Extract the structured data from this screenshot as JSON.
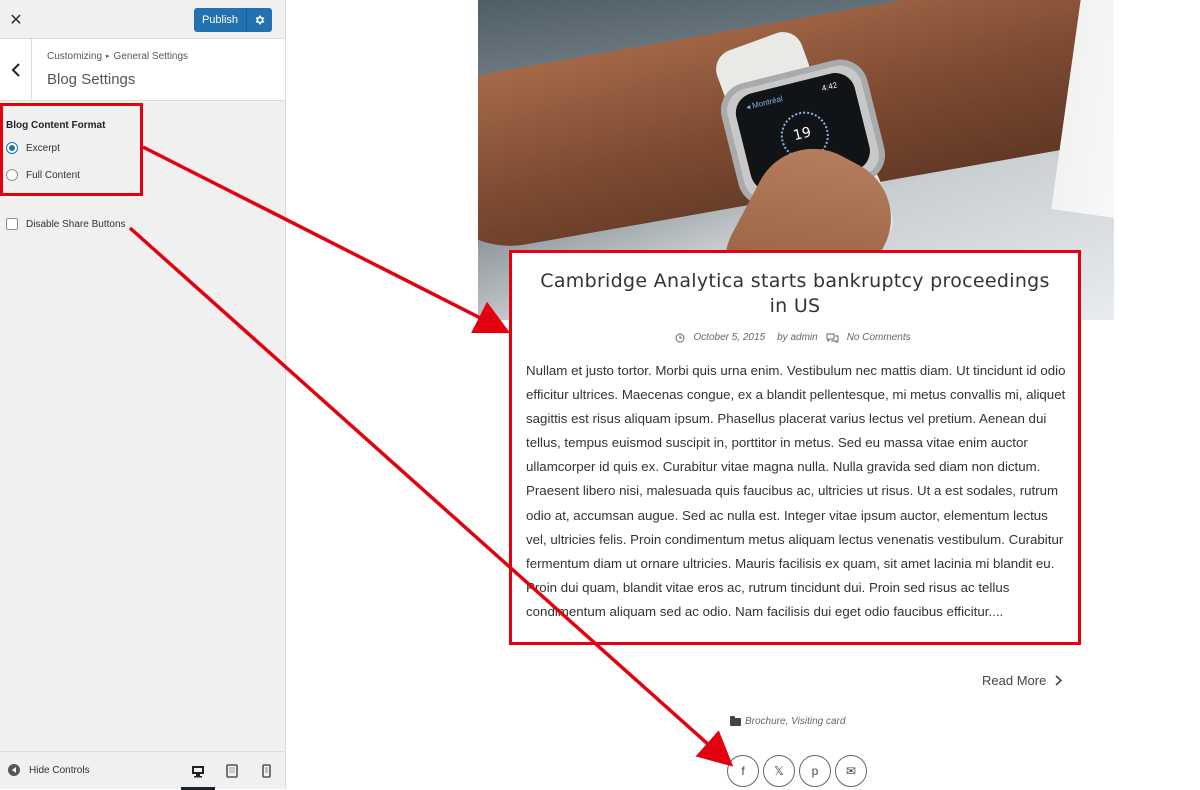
{
  "topbar": {
    "close_icon": "close-icon",
    "publish_label": "Publish",
    "publish_settings_icon": "gear-icon"
  },
  "section": {
    "breadcrumb_root": "Customizing",
    "breadcrumb_parent": "General Settings",
    "title": "Blog Settings"
  },
  "controls": {
    "content_format_label": "Blog Content Format",
    "options": [
      {
        "label": "Excerpt",
        "selected": true
      },
      {
        "label": "Full Content",
        "selected": false
      }
    ],
    "disable_share_label": "Disable Share Buttons",
    "disable_share_checked": false
  },
  "footer": {
    "hide_controls_label": "Hide Controls",
    "devices": [
      {
        "name": "desktop",
        "active": true
      },
      {
        "name": "tablet",
        "active": false
      },
      {
        "name": "mobile",
        "active": false
      }
    ]
  },
  "post": {
    "title": "Cambridge Analytica starts bankruptcy proceedings in US",
    "date": "October 5, 2015",
    "author": "by admin",
    "comments": "No Comments",
    "excerpt": "Nullam et justo tortor. Morbi quis urna enim. Vestibulum nec mattis diam. Ut tincidunt id odio efficitur ultrices. Maecenas congue, ex a blandit pellentesque, mi metus convallis mi, aliquet sagittis est risus aliquam ipsum. Phasellus placerat varius lectus vel pretium. Aenean dui tellus, tempus euismod suscipit in, porttitor in metus. Sed eu massa vitae enim auctor ullamcorper id quis ex. Curabitur vitae magna nulla. Nulla gravida sed diam non dictum. Praesent libero nisi, malesuada quis faucibus ac, ultricies ut risus. Ut a est sodales, rutrum odio at, accumsan augue. Sed ac nulla est. Integer vitae ipsum auctor, elementum lectus vel, ultricies felis. Proin condimentum metus aliquam lectus venenatis vestibulum. Curabitur fermentum diam ut ornare ultricies. Mauris facilisis ex quam, sit amet lacinia mi blandit eu. Proin dui quam, blandit vitae eros ac, rutrum tincidunt dui. Proin sed risus ac tellus condimentum aliquam sed ac odio. Nam facilisis dui eget odio faucibus efficitur....",
    "read_more": "Read More",
    "categories": "Brochure, Visiting card",
    "image": {
      "watch_city": "◂ Montréal",
      "watch_time": "4:42",
      "watch_date": "19"
    }
  },
  "share_buttons": [
    {
      "icon": "facebook-icon",
      "glyph": "f"
    },
    {
      "icon": "x-icon",
      "glyph": "𝕏"
    },
    {
      "icon": "pinterest-icon",
      "glyph": "p"
    },
    {
      "icon": "email-icon",
      "glyph": "✉"
    }
  ],
  "colors": {
    "accent": "#2271b1",
    "highlight": "#e3000f"
  }
}
